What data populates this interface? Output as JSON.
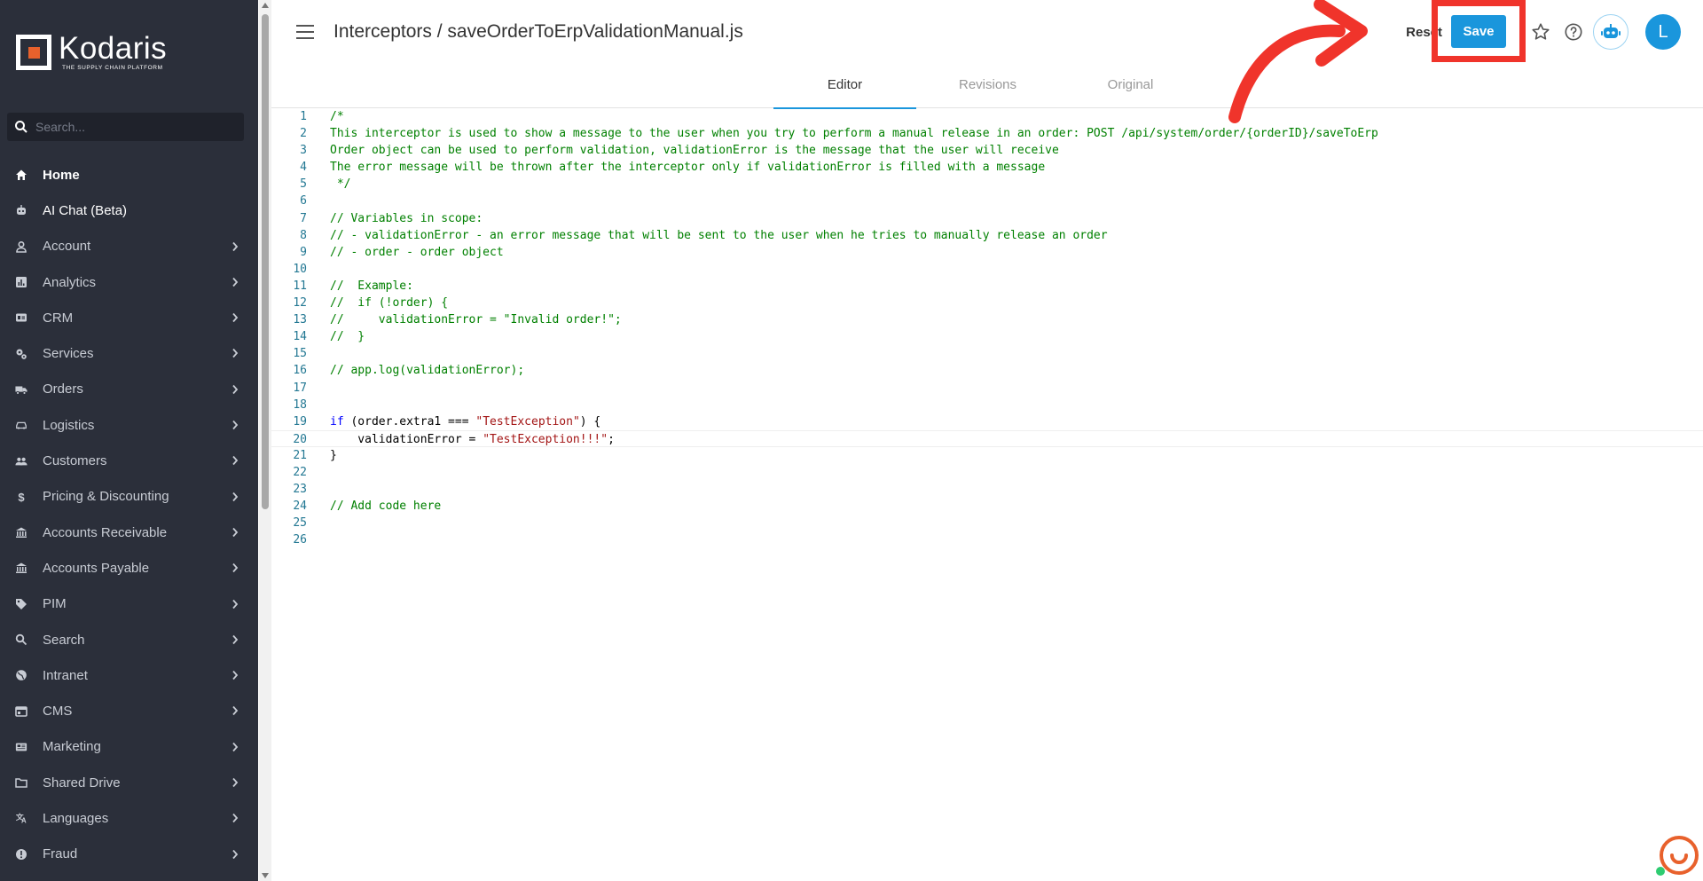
{
  "brand": {
    "name": "Kodaris",
    "tagline": "THE SUPPLY CHAIN PLATFORM",
    "accent_color": "#e8612c",
    "sidebar_bg": "#2b2f3a"
  },
  "search": {
    "placeholder": "Search..."
  },
  "nav": [
    {
      "label": "Home",
      "icon": "home-icon",
      "chevron": false
    },
    {
      "label": "AI Chat (Beta)",
      "icon": "robot-icon",
      "chevron": false
    },
    {
      "label": "Account",
      "icon": "person-icon",
      "chevron": true
    },
    {
      "label": "Analytics",
      "icon": "chart-icon",
      "chevron": true
    },
    {
      "label": "CRM",
      "icon": "id-card-icon",
      "chevron": true
    },
    {
      "label": "Services",
      "icon": "gears-icon",
      "chevron": true
    },
    {
      "label": "Orders",
      "icon": "truck-icon",
      "chevron": true
    },
    {
      "label": "Logistics",
      "icon": "car-icon",
      "chevron": true
    },
    {
      "label": "Customers",
      "icon": "people-icon",
      "chevron": true
    },
    {
      "label": "Pricing & Discounting",
      "icon": "dollar-icon",
      "chevron": true
    },
    {
      "label": "Accounts Receivable",
      "icon": "bank-icon",
      "chevron": true
    },
    {
      "label": "Accounts Payable",
      "icon": "bank-icon",
      "chevron": true
    },
    {
      "label": "PIM",
      "icon": "tag-icon",
      "chevron": true
    },
    {
      "label": "Search",
      "icon": "search-icon",
      "chevron": true
    },
    {
      "label": "Intranet",
      "icon": "globe-icon",
      "chevron": true
    },
    {
      "label": "CMS",
      "icon": "browser-icon",
      "chevron": true
    },
    {
      "label": "Marketing",
      "icon": "newspaper-icon",
      "chevron": true
    },
    {
      "label": "Shared Drive",
      "icon": "folder-icon",
      "chevron": true
    },
    {
      "label": "Languages",
      "icon": "translate-icon",
      "chevron": true
    },
    {
      "label": "Fraud",
      "icon": "alert-icon",
      "chevron": true
    }
  ],
  "header": {
    "title": "Interceptors / saveOrderToErpValidationManual.js",
    "reset_label": "Reset",
    "save_label": "Save",
    "avatar_initial": "L",
    "save_color": "#1a96dc",
    "highlight_color": "#f0342b"
  },
  "tabs": [
    {
      "label": "Editor",
      "active": true
    },
    {
      "label": "Revisions",
      "active": false
    },
    {
      "label": "Original",
      "active": false
    }
  ],
  "code_lines": [
    {
      "n": "1",
      "parts": [
        [
          "c",
          "/*"
        ]
      ]
    },
    {
      "n": "2",
      "parts": [
        [
          "c",
          "This interceptor is used to show a message to the user when you try to perform a manual release in an order: POST /api/system/order/{orderID}/saveToErp"
        ]
      ]
    },
    {
      "n": "3",
      "parts": [
        [
          "c",
          "Order object can be used to perform validation, validationError is the message that the user will receive"
        ]
      ]
    },
    {
      "n": "4",
      "parts": [
        [
          "c",
          "The error message will be thrown after the interceptor only if validationError is filled with a message"
        ]
      ]
    },
    {
      "n": "5",
      "parts": [
        [
          "c",
          " */"
        ]
      ]
    },
    {
      "n": "6",
      "parts": []
    },
    {
      "n": "7",
      "parts": [
        [
          "c",
          "// Variables in scope:"
        ]
      ]
    },
    {
      "n": "8",
      "parts": [
        [
          "c",
          "// - validationError - an error message that will be sent to the user when he tries to manually release an order"
        ]
      ]
    },
    {
      "n": "9",
      "parts": [
        [
          "c",
          "// - order - order object"
        ]
      ]
    },
    {
      "n": "10",
      "parts": []
    },
    {
      "n": "11",
      "parts": [
        [
          "c",
          "//  Example:"
        ]
      ]
    },
    {
      "n": "12",
      "parts": [
        [
          "c",
          "//  if (!order) {"
        ]
      ]
    },
    {
      "n": "13",
      "parts": [
        [
          "c",
          "//     validationError = \"Invalid order!\";"
        ]
      ]
    },
    {
      "n": "14",
      "parts": [
        [
          "c",
          "//  }"
        ]
      ]
    },
    {
      "n": "15",
      "parts": []
    },
    {
      "n": "16",
      "parts": [
        [
          "c",
          "// app.log(validationError);"
        ]
      ]
    },
    {
      "n": "17",
      "parts": []
    },
    {
      "n": "18",
      "parts": []
    },
    {
      "n": "19",
      "parts": [
        [
          "k",
          "if"
        ],
        [
          "p",
          " (order.extra1 === "
        ],
        [
          "s",
          "\"TestException\""
        ],
        [
          "p",
          ") {"
        ]
      ]
    },
    {
      "n": "20",
      "parts": [
        [
          "p",
          "    validationError = "
        ],
        [
          "s",
          "\"TestException!!!\""
        ],
        [
          "p",
          ";"
        ]
      ]
    },
    {
      "n": "21",
      "parts": [
        [
          "p",
          "}"
        ]
      ]
    },
    {
      "n": "22",
      "parts": []
    },
    {
      "n": "23",
      "parts": []
    },
    {
      "n": "24",
      "parts": [
        [
          "c",
          "// Add code here"
        ]
      ]
    },
    {
      "n": "25",
      "parts": []
    },
    {
      "n": "26",
      "parts": []
    }
  ]
}
